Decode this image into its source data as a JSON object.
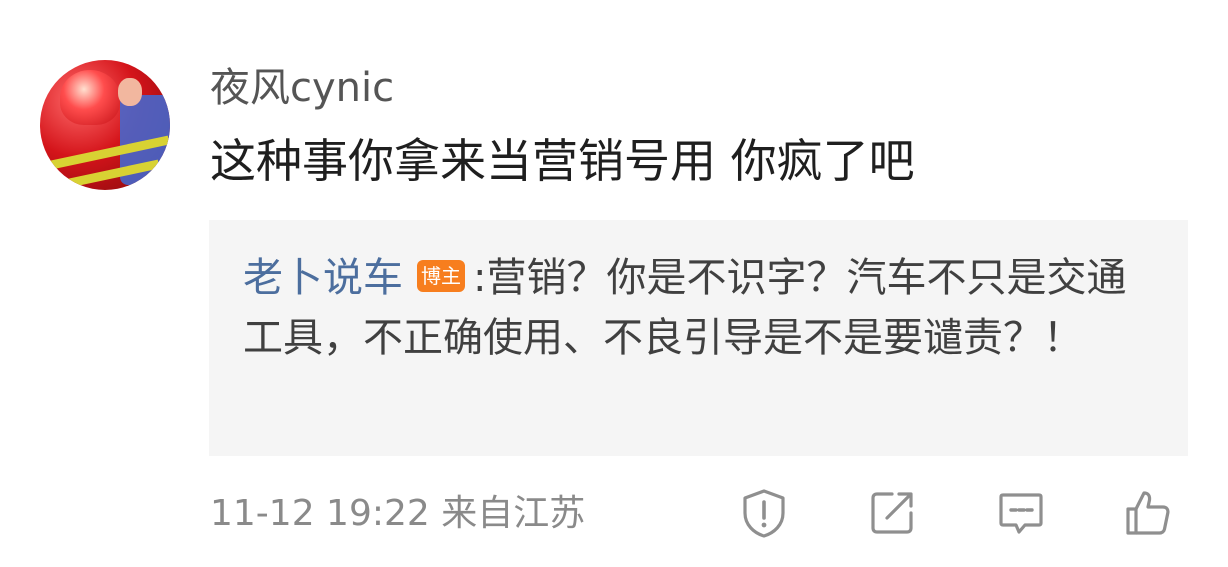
{
  "comment": {
    "username": "夜风cynic",
    "text": "这种事你拿来当营销号用 你疯了吧",
    "timestamp": "11-12 19:22",
    "location": "来自江苏"
  },
  "reply": {
    "author": "老卜说车",
    "badge": "博主",
    "separator": ":",
    "text": "营销？你是不识字？汽车不只是交通工具，不正确使用、不良引导是不是要谴责？！"
  },
  "actions": [
    {
      "name": "report",
      "icon": "shield-exclamation-icon"
    },
    {
      "name": "share",
      "icon": "share-icon"
    },
    {
      "name": "comment",
      "icon": "comment-icon"
    },
    {
      "name": "like",
      "icon": "thumbs-up-icon"
    }
  ],
  "colors": {
    "author_link": "#4c6e9e",
    "badge_bg": "#f77e1e",
    "quote_bg": "#f5f5f5",
    "secondary_text": "#8a8a8a"
  }
}
